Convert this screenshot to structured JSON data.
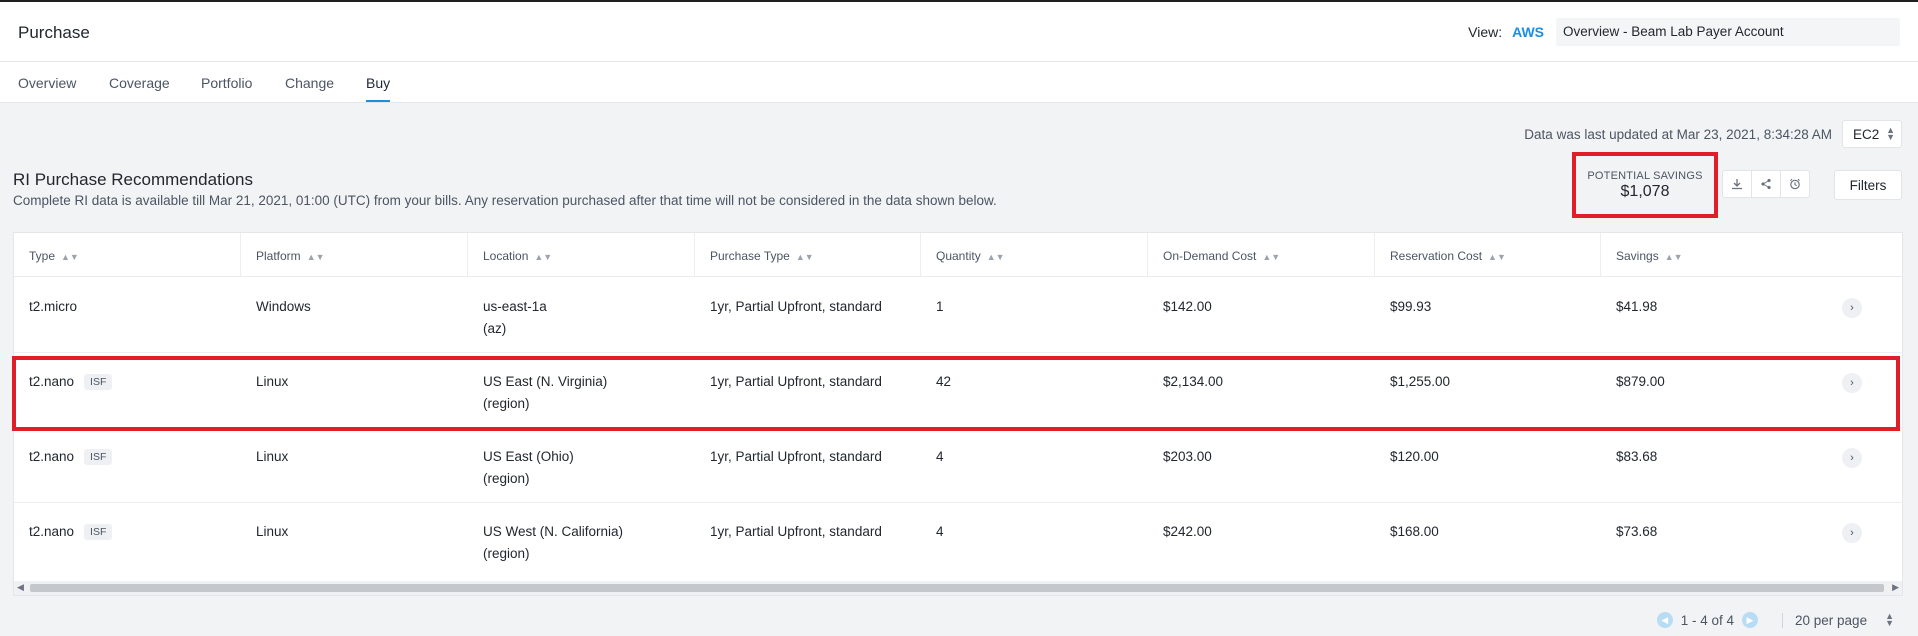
{
  "header": {
    "title": "Purchase",
    "view_label": "View:",
    "view_cloud": "AWS",
    "view_account": "Overview - Beam Lab Payer Account"
  },
  "tabs": [
    {
      "label": "Overview",
      "active": false
    },
    {
      "label": "Coverage",
      "active": false
    },
    {
      "label": "Portfolio",
      "active": false
    },
    {
      "label": "Change",
      "active": false
    },
    {
      "label": "Buy",
      "active": true
    }
  ],
  "toolbar": {
    "updated_text": "Data was last updated at Mar 23, 2021, 8:34:28 AM",
    "service": "EC2",
    "filters_label": "Filters"
  },
  "section": {
    "title": "RI Purchase Recommendations",
    "subtitle": "Complete RI data is available till Mar 21, 2021, 01:00 (UTC) from your bills. Any reservation purchased after that time will not be considered in the data shown below."
  },
  "savings": {
    "label": "POTENTIAL SAVINGS",
    "value": "$1,078"
  },
  "table": {
    "columns": [
      "Type",
      "Platform",
      "Location",
      "Purchase Type",
      "Quantity",
      "On-Demand Cost",
      "Reservation Cost",
      "Savings"
    ],
    "rows": [
      {
        "type": "t2.micro",
        "isf": "",
        "platform": "Windows",
        "location": "us-east-1a",
        "location_sub": "(az)",
        "purchase_type": "1yr, Partial Upfront, standard",
        "quantity": "1",
        "on_demand": "$142.00",
        "reservation": "$99.93",
        "savings": "$41.98"
      },
      {
        "type": "t2.nano",
        "isf": "ISF",
        "platform": "Linux",
        "location": "US East (N. Virginia)",
        "location_sub": "(region)",
        "purchase_type": "1yr, Partial Upfront, standard",
        "quantity": "42",
        "on_demand": "$2,134.00",
        "reservation": "$1,255.00",
        "savings": "$879.00"
      },
      {
        "type": "t2.nano",
        "isf": "ISF",
        "platform": "Linux",
        "location": "US East (Ohio)",
        "location_sub": "(region)",
        "purchase_type": "1yr, Partial Upfront, standard",
        "quantity": "4",
        "on_demand": "$203.00",
        "reservation": "$120.00",
        "savings": "$83.68"
      },
      {
        "type": "t2.nano",
        "isf": "ISF",
        "platform": "Linux",
        "location": "US West (N. California)",
        "location_sub": "(region)",
        "purchase_type": "1yr, Partial Upfront, standard",
        "quantity": "4",
        "on_demand": "$242.00",
        "reservation": "$168.00",
        "savings": "$73.68"
      }
    ]
  },
  "pagination": {
    "range": "1 - 4 of 4",
    "per_page": "20 per page"
  },
  "colors": {
    "accent": "#1b8ee0",
    "highlight": "#e11d2a"
  }
}
